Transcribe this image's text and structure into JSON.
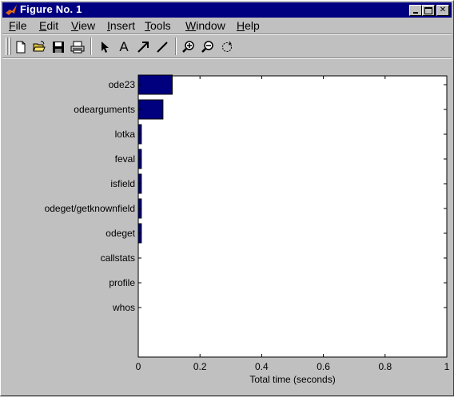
{
  "window": {
    "title": "Figure No. 1"
  },
  "menu": [
    {
      "label": "File",
      "hot": "F",
      "rest": "ile"
    },
    {
      "label": "Edit",
      "hot": "E",
      "rest": "dit"
    },
    {
      "label": "View",
      "hot": "V",
      "rest": "iew"
    },
    {
      "label": "Insert",
      "hot": "I",
      "rest": "nsert"
    },
    {
      "label": "Tools",
      "hot": "T",
      "rest": "ools"
    },
    {
      "label": "Window",
      "hot": "W",
      "rest": "indow"
    },
    {
      "label": "Help",
      "hot": "H",
      "rest": "elp"
    }
  ],
  "toolbar": [
    "new-file",
    "open-file",
    "save",
    "print",
    "select-arrow",
    "insert-text",
    "insert-arrow",
    "insert-line",
    "zoom-in",
    "zoom-out",
    "rotate-3d"
  ],
  "chart_data": {
    "type": "bar",
    "orientation": "horizontal",
    "categories": [
      "ode23",
      "odearguments",
      "lotka",
      "feval",
      "isfield",
      "odeget/getknownfield",
      "odeget",
      "callstats",
      "profile",
      "whos"
    ],
    "values": [
      0.11,
      0.08,
      0.01,
      0.01,
      0.01,
      0.01,
      0.01,
      0,
      0,
      0
    ],
    "xlabel": "Total time (seconds)",
    "ylabel": "",
    "xlim": [
      0,
      1
    ],
    "xticks": [
      "0",
      "0.2",
      "0.4",
      "0.6",
      "0.8",
      "1"
    ],
    "grid": false,
    "bar_color": "#00007f"
  }
}
